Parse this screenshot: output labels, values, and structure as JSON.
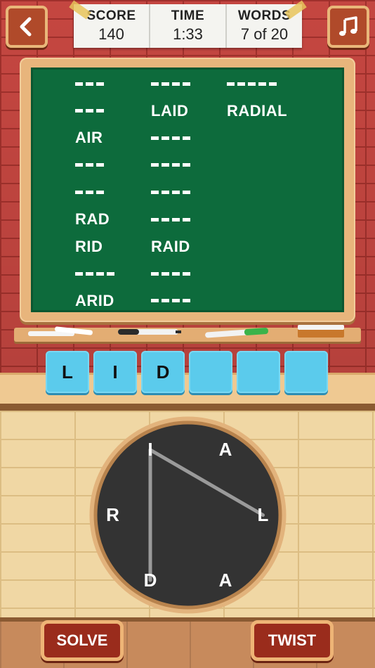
{
  "scoreboard": {
    "score_label": "SCORE",
    "score_value": "140",
    "time_label": "TIME",
    "time_value": "1:33",
    "words_label": "WORDS",
    "words_value": "7 of 20"
  },
  "board": {
    "columns": [
      [
        {
          "text": "",
          "length": 3
        },
        {
          "text": "",
          "length": 3
        },
        {
          "text": "AIR",
          "length": 3
        },
        {
          "text": "",
          "length": 3
        },
        {
          "text": "",
          "length": 3
        },
        {
          "text": "RAD",
          "length": 3
        },
        {
          "text": "RID",
          "length": 3
        },
        {
          "text": "",
          "length": 4
        },
        {
          "text": "ARID",
          "length": 4
        }
      ],
      [
        {
          "text": "",
          "length": 4
        },
        {
          "text": "LAID",
          "length": 4
        },
        {
          "text": "",
          "length": 4
        },
        {
          "text": "",
          "length": 4
        },
        {
          "text": "",
          "length": 4
        },
        {
          "text": "",
          "length": 4
        },
        {
          "text": "RAID",
          "length": 4
        },
        {
          "text": "",
          "length": 4
        },
        {
          "text": "",
          "length": 4
        }
      ],
      [
        {
          "text": "",
          "length": 5
        },
        {
          "text": "RADIAL",
          "length": 6
        }
      ]
    ]
  },
  "slots": [
    "L",
    "I",
    "D",
    "",
    "",
    ""
  ],
  "wheel": {
    "letters": [
      {
        "char": "I",
        "angle": 240
      },
      {
        "char": "A",
        "angle": 300
      },
      {
        "char": "L",
        "angle": 0
      },
      {
        "char": "A",
        "angle": 60
      },
      {
        "char": "D",
        "angle": 120
      },
      {
        "char": "R",
        "angle": 180
      }
    ],
    "path": [
      2,
      0,
      4
    ]
  },
  "buttons": {
    "solve": "SOLVE",
    "twist": "TWIST"
  },
  "icons": {
    "back": "chevron-left-icon",
    "music": "music-note-icon"
  },
  "colors": {
    "board": "#0d6b3c",
    "slot": "#5bcbec",
    "button": "#9a2c1c",
    "wheel": "#333333"
  }
}
